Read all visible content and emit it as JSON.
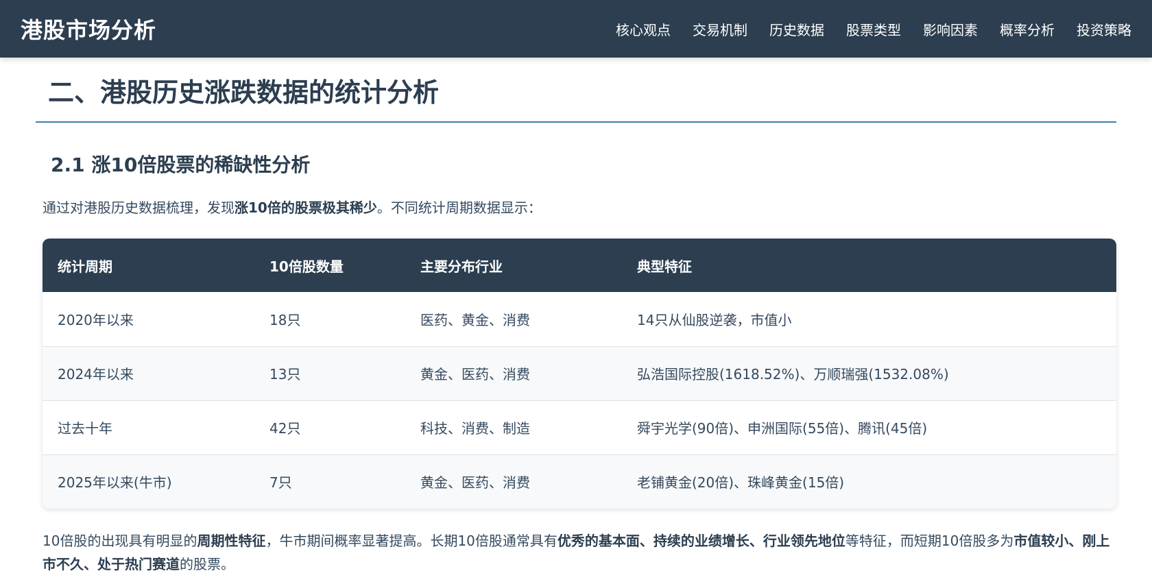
{
  "nav": {
    "brand": "港股市场分析",
    "links": [
      "核心观点",
      "交易机制",
      "历史数据",
      "股票类型",
      "影响因素",
      "概率分析",
      "投资策略"
    ]
  },
  "section": {
    "title": "二、港股历史涨跌数据的统计分析",
    "subtitle": "2.1 涨10倍股票的稀缺性分析",
    "intro": {
      "before": "通过对港股历史数据梳理，发现",
      "bold": "涨10倍的股票极其稀少",
      "after": "。不同统计周期数据显示："
    }
  },
  "table": {
    "headers": [
      "统计周期",
      "10倍股数量",
      "主要分布行业",
      "典型特征"
    ],
    "rows": [
      [
        "2020年以来",
        "18只",
        "医药、黄金、消费",
        "14只从仙股逆袭，市值小"
      ],
      [
        "2024年以来",
        "13只",
        "黄金、医药、消费",
        "弘浩国际控股(1618.52%)、万顺瑞强(1532.08%)"
      ],
      [
        "过去十年",
        "42只",
        "科技、消费、制造",
        "舜宇光学(90倍)、申洲国际(55倍)、腾讯(45倍)"
      ],
      [
        "2025年以来(牛市)",
        "7只",
        "黄金、医药、消费",
        "老铺黄金(20倍)、珠峰黄金(15倍)"
      ]
    ]
  },
  "conclusion": {
    "t1": "10倍股的出现具有明显的",
    "b1": "周期性特征",
    "t2": "，牛市期间概率显著提高。长期10倍股通常具有",
    "b2": "优秀的基本面、持续的业绩增长、行业领先地位",
    "t3": "等特征，而短期10倍股多为",
    "b3": "市值较小、刚上市不久、处于热门赛道",
    "t4": "的股票。"
  }
}
